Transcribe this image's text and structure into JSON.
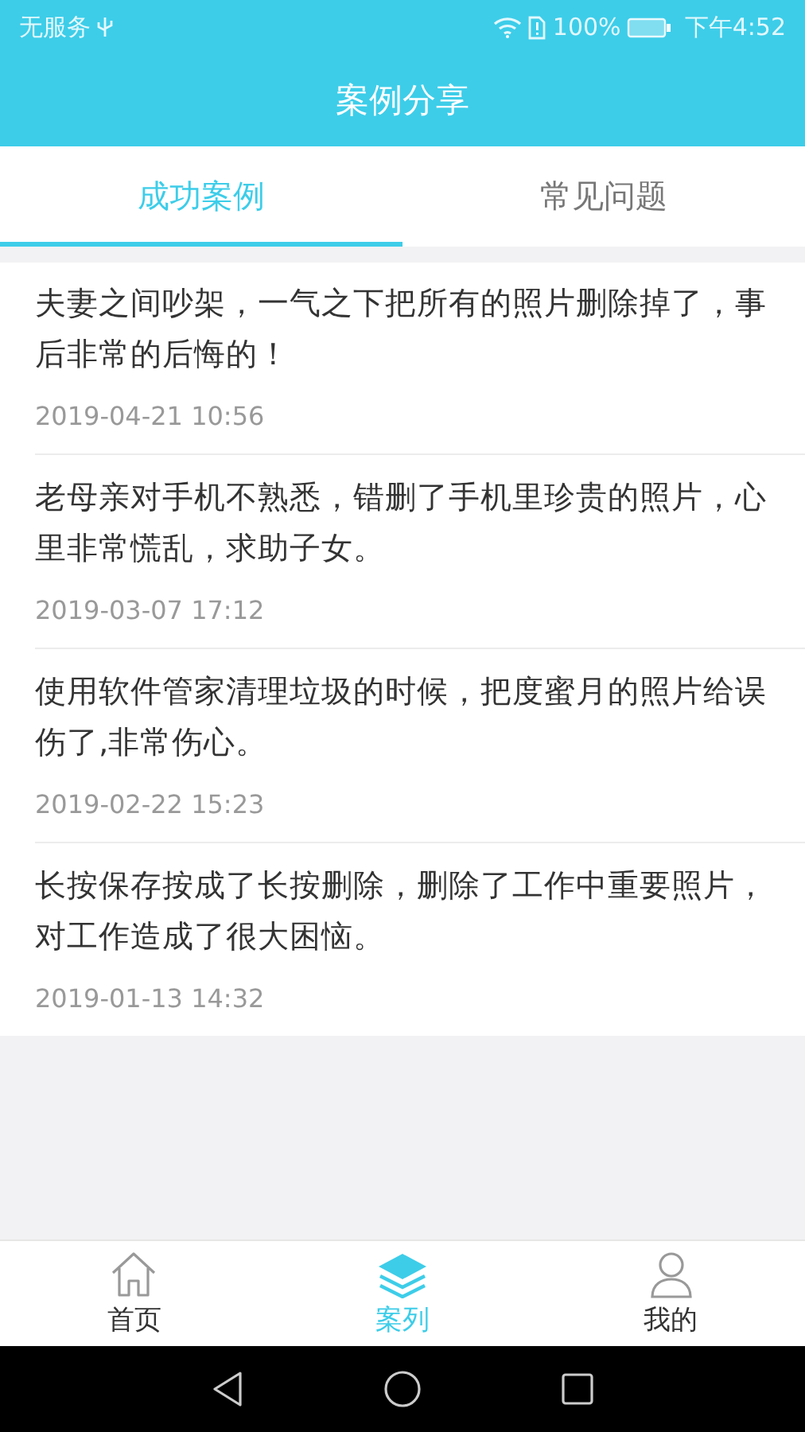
{
  "status_bar": {
    "carrier": "无服务",
    "battery": "100%",
    "time": "下午4:52"
  },
  "header": {
    "title": "案例分享"
  },
  "tabs": [
    {
      "label": "成功案例",
      "selected": true
    },
    {
      "label": "常见问题",
      "selected": false
    }
  ],
  "cases": [
    {
      "text": "夫妻之间吵架，一气之下把所有的照片删除掉了，事后非常的后悔的！",
      "date": "2019-04-21 10:56"
    },
    {
      "text": "老母亲对手机不熟悉，错删了手机里珍贵的照片，心里非常慌乱，求助子女。",
      "date": "2019-03-07 17:12"
    },
    {
      "text": "使用软件管家清理垃圾的时候，把度蜜月的照片给误伤了,非常伤心。",
      "date": "2019-02-22 15:23"
    },
    {
      "text": "长按保存按成了长按删除，删除了工作中重要照片，对工作造成了很大困恼。",
      "date": "2019-01-13 14:32"
    }
  ],
  "bottom_nav": [
    {
      "label": "首页",
      "kind": "home",
      "selected": false
    },
    {
      "label": "案列",
      "kind": "layers",
      "selected": true
    },
    {
      "label": "我的",
      "kind": "person",
      "selected": false
    }
  ]
}
